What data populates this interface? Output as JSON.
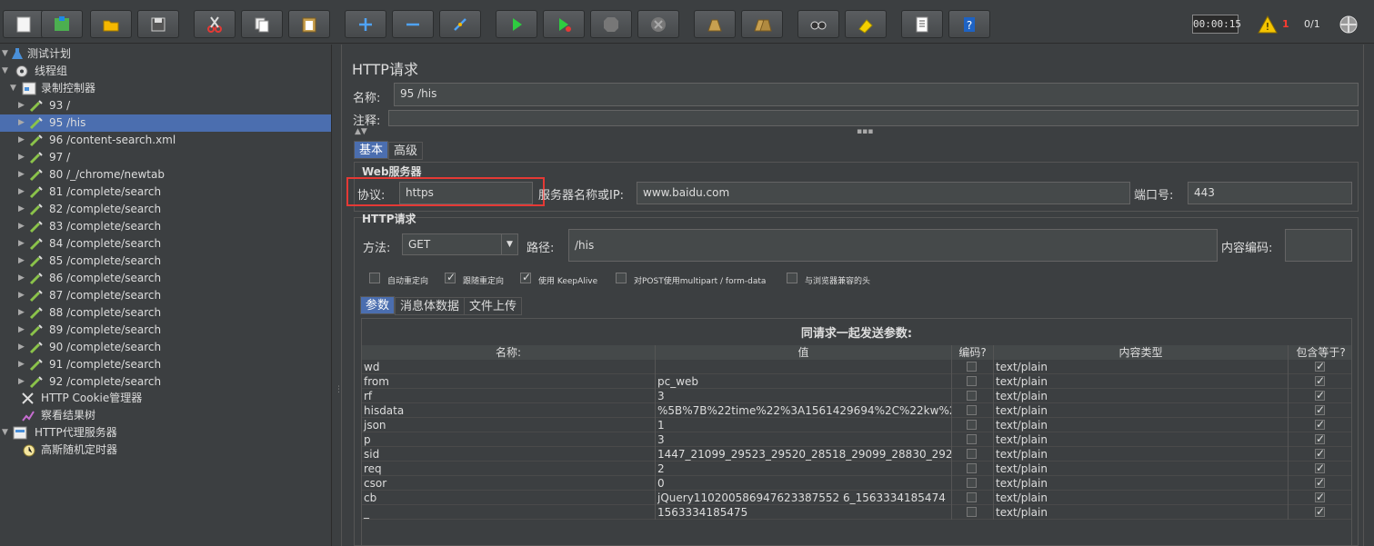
{
  "toolbar": {
    "buttons": [
      "new-icon",
      "templates-icon",
      "open-icon",
      "save-icon",
      "cut-icon",
      "copy-icon",
      "paste-icon",
      "expand-icon",
      "collapse-icon",
      "toggle-icon",
      "start-icon",
      "start-no-pause-icon",
      "stop-icon",
      "shutdown-icon",
      "clear-icon",
      "clear-all-icon",
      "search-icon",
      "reset-search-icon",
      "function-helper-icon",
      "help-icon"
    ],
    "timer": "00:00:15",
    "warning_count": "1",
    "threads": "0/1"
  },
  "tree": {
    "test_plan": "测试计划",
    "thread_group": "线程组",
    "recording_controller": "录制控制器",
    "samplers": [
      "93 /",
      "95 /his",
      "96 /content-search.xml",
      "97 /",
      "80 /_/chrome/newtab",
      "81 /complete/search",
      "82 /complete/search",
      "83 /complete/search",
      "84 /complete/search",
      "85 /complete/search",
      "86 /complete/search",
      "87 /complete/search",
      "88 /complete/search",
      "89 /complete/search",
      "90 /complete/search",
      "91 /complete/search",
      "92 /complete/search"
    ],
    "cookie_manager": "HTTP Cookie管理器",
    "result_tree": "察看结果树",
    "proxy_server": "HTTP代理服务器",
    "gaussian_timer": "高斯随机定时器"
  },
  "panel": {
    "title": "HTTP请求",
    "name_label": "名称:",
    "name_value": "95 /his",
    "comment_label": "注释:",
    "tabs": [
      "基本",
      "高级"
    ],
    "web_server_title": "Web服务器",
    "protocol_label": "协议:",
    "protocol_value": "https",
    "server_label": "服务器名称或IP:",
    "server_value": "www.baidu.com",
    "port_label": "端口号:",
    "port_value": "443",
    "http_request_title": "HTTP请求",
    "method_label": "方法:",
    "method_value": "GET",
    "path_label": "路径:",
    "path_value": "/his",
    "encoding_label": "内容编码:",
    "checkboxes": [
      {
        "label": "自动重定向",
        "checked": false
      },
      {
        "label": "跟随重定向",
        "checked": true
      },
      {
        "label": "使用 KeepAlive",
        "checked": true
      },
      {
        "label": "对POST使用multipart / form-data",
        "checked": false
      },
      {
        "label": "与浏览器兼容的头",
        "checked": false
      }
    ],
    "sub_tabs": [
      "参数",
      "消息体数据",
      "文件上传"
    ],
    "params_title": "同请求一起发送参数:",
    "columns": [
      "名称:",
      "值",
      "编码?",
      "内容类型",
      "包含等于?"
    ],
    "rows": [
      {
        "name": "wd",
        "value": "",
        "type": "text/plain"
      },
      {
        "name": "from",
        "value": "pc_web",
        "type": "text/plain"
      },
      {
        "name": "rf",
        "value": "3",
        "type": "text/plain"
      },
      {
        "name": "hisdata",
        "value": "%5B%7B%22time%22%3A1561429694%2C%22kw%22...",
        "type": "text/plain"
      },
      {
        "name": "json",
        "value": "1",
        "type": "text/plain"
      },
      {
        "name": "p",
        "value": "3",
        "type": "text/plain"
      },
      {
        "name": "sid",
        "value": "1447_21099_29523_29520_28518_29099_28830_292...",
        "type": "text/plain"
      },
      {
        "name": "req",
        "value": "2",
        "type": "text/plain"
      },
      {
        "name": "csor",
        "value": "0",
        "type": "text/plain"
      },
      {
        "name": "cb",
        "value": "jQuery110200586947623387552 6_1563334185474",
        "type": "text/plain"
      },
      {
        "name": "_",
        "value": "1563334185475",
        "type": "text/plain"
      }
    ]
  }
}
